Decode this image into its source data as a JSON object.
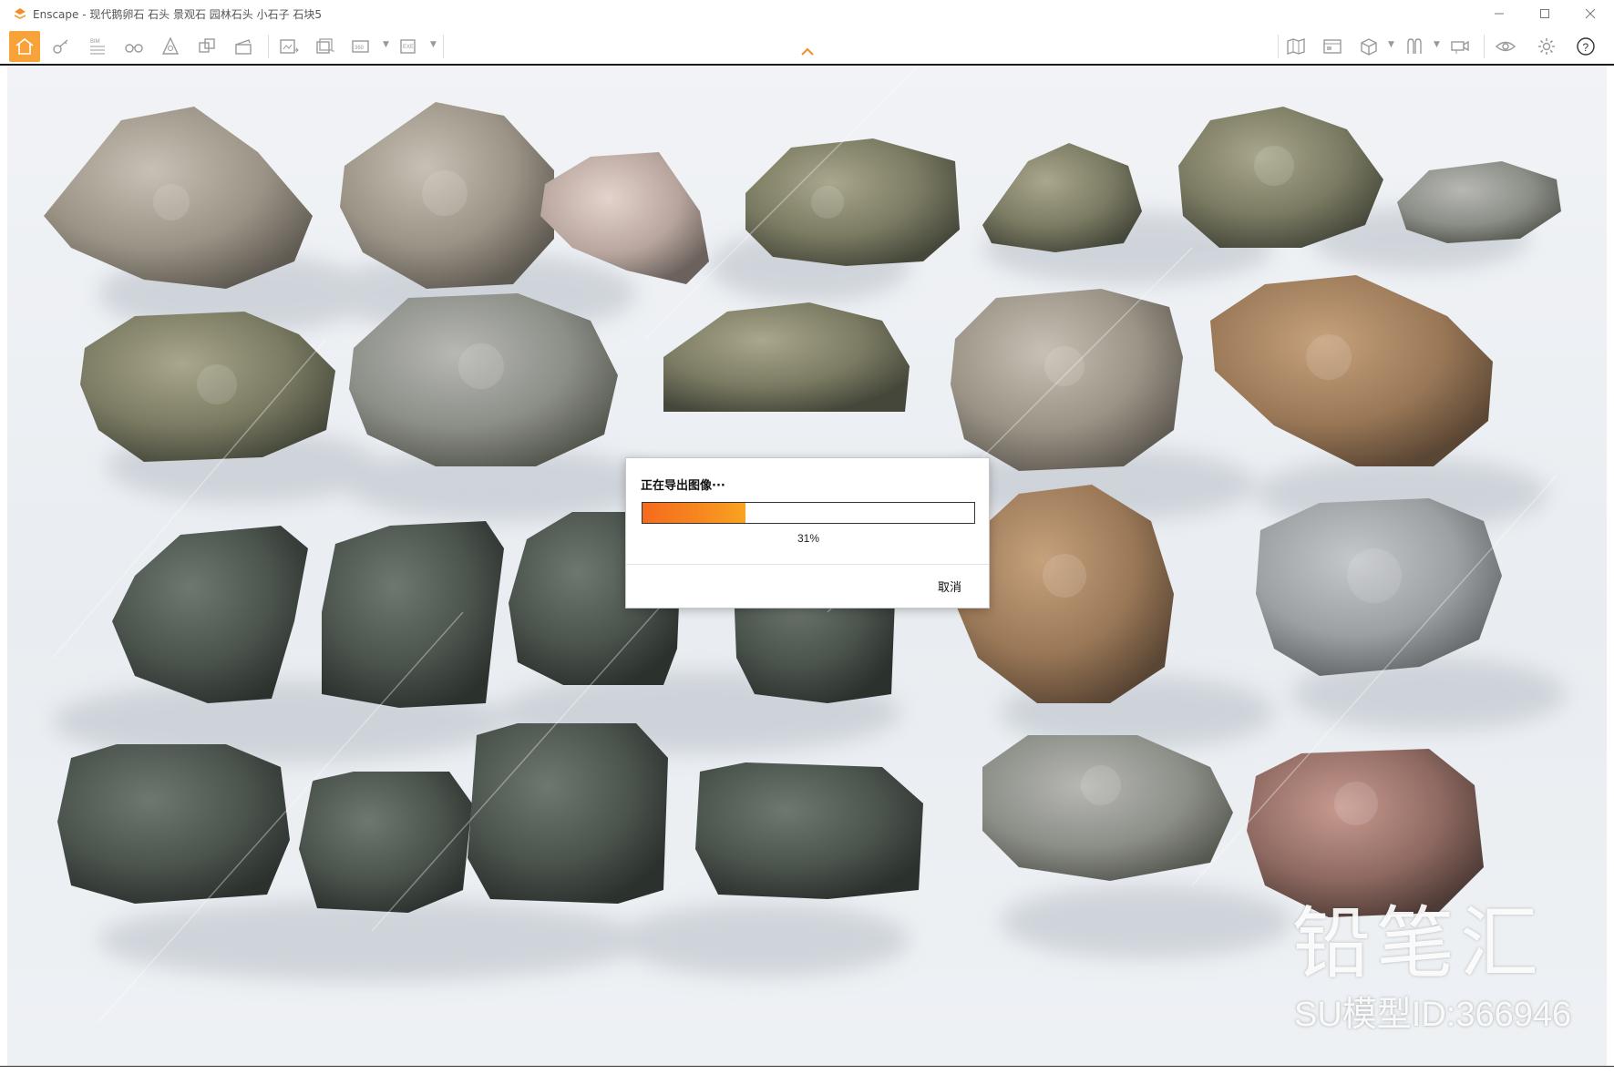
{
  "window": {
    "title": "Enscape - 现代鹅卵石 石头 景观石 园林石头 小石子 石块5"
  },
  "toolbar": {
    "left_groups": [
      {
        "name": "home",
        "icon": "home-icon",
        "active": true
      },
      {
        "name": "navigation",
        "icon": "key-icon"
      },
      {
        "name": "bim",
        "icon": "bim-icon",
        "label": "BIM"
      },
      {
        "name": "view",
        "icon": "binoculars-icon"
      },
      {
        "name": "objects",
        "icon": "asset-icon"
      },
      {
        "name": "materials",
        "icon": "cube-stack-icon"
      },
      {
        "name": "clapper",
        "icon": "clapper-icon"
      },
      {
        "name": "render",
        "icon": "render-image-icon"
      },
      {
        "name": "batch",
        "icon": "batch-render-icon"
      },
      {
        "name": "pano",
        "icon": "panorama-icon",
        "label": "360°"
      },
      {
        "name": "exe",
        "icon": "export-exe-icon",
        "label": "EXE"
      }
    ],
    "right_groups": [
      {
        "name": "map",
        "icon": "map-icon"
      },
      {
        "name": "views",
        "icon": "gallery-icon"
      },
      {
        "name": "box",
        "icon": "box-icon"
      },
      {
        "name": "columns",
        "icon": "columns-icon"
      },
      {
        "name": "collab",
        "icon": "collab-icon"
      },
      {
        "name": "visual",
        "icon": "eye-icon"
      },
      {
        "name": "settings",
        "icon": "gear-icon"
      },
      {
        "name": "help",
        "icon": "help-icon",
        "label": "?"
      }
    ]
  },
  "watermark": {
    "brand": "铅笔汇",
    "model_id": "SU模型ID:366946"
  },
  "dialog": {
    "title": "正在导出图像···",
    "progress": 31,
    "progress_text": "31%",
    "cancel_label": "取消"
  },
  "colors": {
    "accent": "#f7a33a",
    "progress_start": "#f46b1e",
    "progress_end": "#f9a321"
  }
}
